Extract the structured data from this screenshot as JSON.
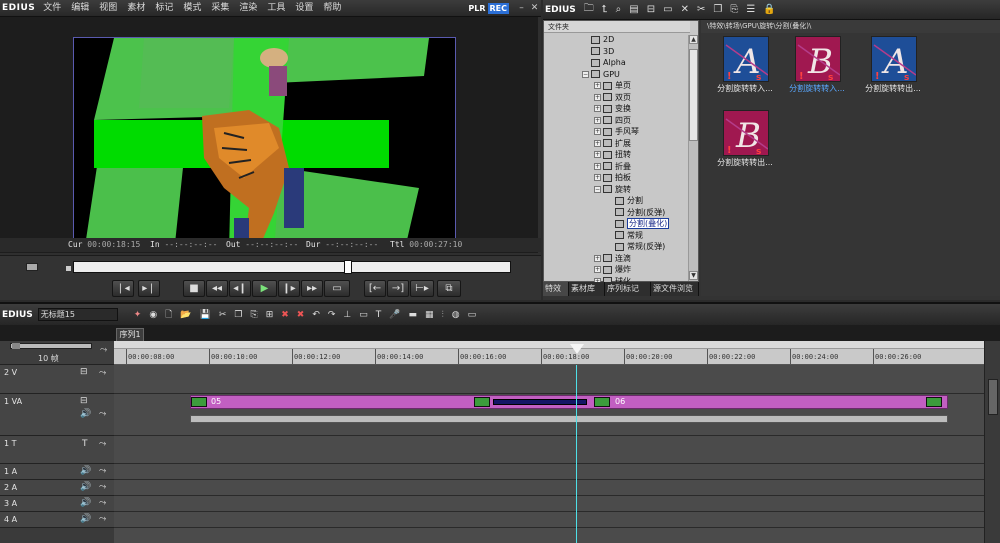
{
  "player": {
    "logo": "EDIUS",
    "menu": [
      "文件",
      "编辑",
      "视图",
      "素材",
      "标记",
      "模式",
      "采集",
      "渲染",
      "工具",
      "设置",
      "帮助"
    ],
    "plr": "PLR",
    "rec": "REC",
    "minimize": "–",
    "close": "✕",
    "cur_label": "Cur",
    "cur_value": "00:00:18:15",
    "in_label": "In",
    "in_value": "--:--:--:--",
    "out_label": "Out",
    "out_value": "--:--:--:--",
    "dur_label": "Dur",
    "dur_value": "--:--:--:--",
    "ttl_label": "Ttl",
    "ttl_value": "00:00:27:10",
    "controls": [
      "❘◂",
      "▸❘",
      "■",
      "◂◂",
      "◂❙",
      "▶",
      "❙▸",
      "▸▸",
      "▭",
      "[←",
      "→]",
      "⊢▸",
      "⧉"
    ],
    "scrub_position": 0.625
  },
  "bin": {
    "logo": "EDIUS",
    "tree_header": "文件夹",
    "tree": [
      {
        "label": "2D",
        "level": 3,
        "expand": "",
        "sel": false
      },
      {
        "label": "3D",
        "level": 3,
        "expand": "",
        "sel": false
      },
      {
        "label": "Alpha",
        "level": 3,
        "expand": "",
        "sel": false
      },
      {
        "label": "GPU",
        "level": 3,
        "expand": "−",
        "sel": false
      },
      {
        "label": "单页",
        "level": 4,
        "expand": "+",
        "sel": false
      },
      {
        "label": "双页",
        "level": 4,
        "expand": "+",
        "sel": false
      },
      {
        "label": "变换",
        "level": 4,
        "expand": "+",
        "sel": false
      },
      {
        "label": "四页",
        "level": 4,
        "expand": "+",
        "sel": false
      },
      {
        "label": "手风琴",
        "level": 4,
        "expand": "+",
        "sel": false
      },
      {
        "label": "扩展",
        "level": 4,
        "expand": "+",
        "sel": false
      },
      {
        "label": "扭转",
        "level": 4,
        "expand": "+",
        "sel": false
      },
      {
        "label": "折叠",
        "level": 4,
        "expand": "+",
        "sel": false
      },
      {
        "label": "拍板",
        "level": 4,
        "expand": "+",
        "sel": false
      },
      {
        "label": "旋转",
        "level": 4,
        "expand": "−",
        "sel": false
      },
      {
        "label": "分割",
        "level": 5,
        "expand": "",
        "sel": false
      },
      {
        "label": "分割(反弹)",
        "level": 5,
        "expand": "",
        "sel": false
      },
      {
        "label": "分割(叠化)",
        "level": 5,
        "expand": "",
        "sel": true
      },
      {
        "label": "常规",
        "level": 5,
        "expand": "",
        "sel": false
      },
      {
        "label": "常规(反弹)",
        "level": 5,
        "expand": "",
        "sel": false
      },
      {
        "label": "连滴",
        "level": 4,
        "expand": "+",
        "sel": false
      },
      {
        "label": "爆炸",
        "level": 4,
        "expand": "+",
        "sel": false
      },
      {
        "label": "球化",
        "level": 4,
        "expand": "+",
        "sel": false
      }
    ],
    "tabs": [
      "特效",
      "素材库",
      "序列标记",
      "源文件浏览"
    ],
    "path": "\\特效\\转场\\GPU\\旋转\\分割(叠化)\\",
    "clips": [
      {
        "label": "分割旋转转入...",
        "letter": "A",
        "bg": "#1e4e98",
        "sel": false
      },
      {
        "label": "分割旋转转入...",
        "letter": "B",
        "bg": "#a01850",
        "sel": true
      },
      {
        "label": "分割旋转转出...",
        "letter": "A",
        "bg": "#1e4e98",
        "sel": false
      },
      {
        "label": "分割旋转转出...",
        "letter": "B",
        "bg": "#a01850",
        "sel": false
      }
    ]
  },
  "timeline": {
    "logo": "EDIUS",
    "project_name": "无标题15",
    "sequence_tab": "序列1",
    "zoom": "10 帧",
    "ruler_labels": [
      "00:00:08:00",
      "00:00:10:00",
      "00:00:12:00",
      "00:00:14:00",
      "00:00:16:00",
      "00:00:18:00",
      "00:00:20:00",
      "00:00:22:00",
      "00:00:24:00",
      "00:00:26:00"
    ],
    "tracks": [
      {
        "name": "2 V",
        "type": "V"
      },
      {
        "name": "1 VA",
        "type": "VA"
      },
      {
        "name": "1 T",
        "type": "T"
      },
      {
        "name": "1 A",
        "type": "A"
      },
      {
        "name": "2 A",
        "type": "A"
      },
      {
        "name": "3 A",
        "type": "A"
      },
      {
        "name": "4 A",
        "type": "A"
      }
    ],
    "clip_a_label": "05",
    "clip_b_label": "06",
    "accent": "#c060c0"
  }
}
